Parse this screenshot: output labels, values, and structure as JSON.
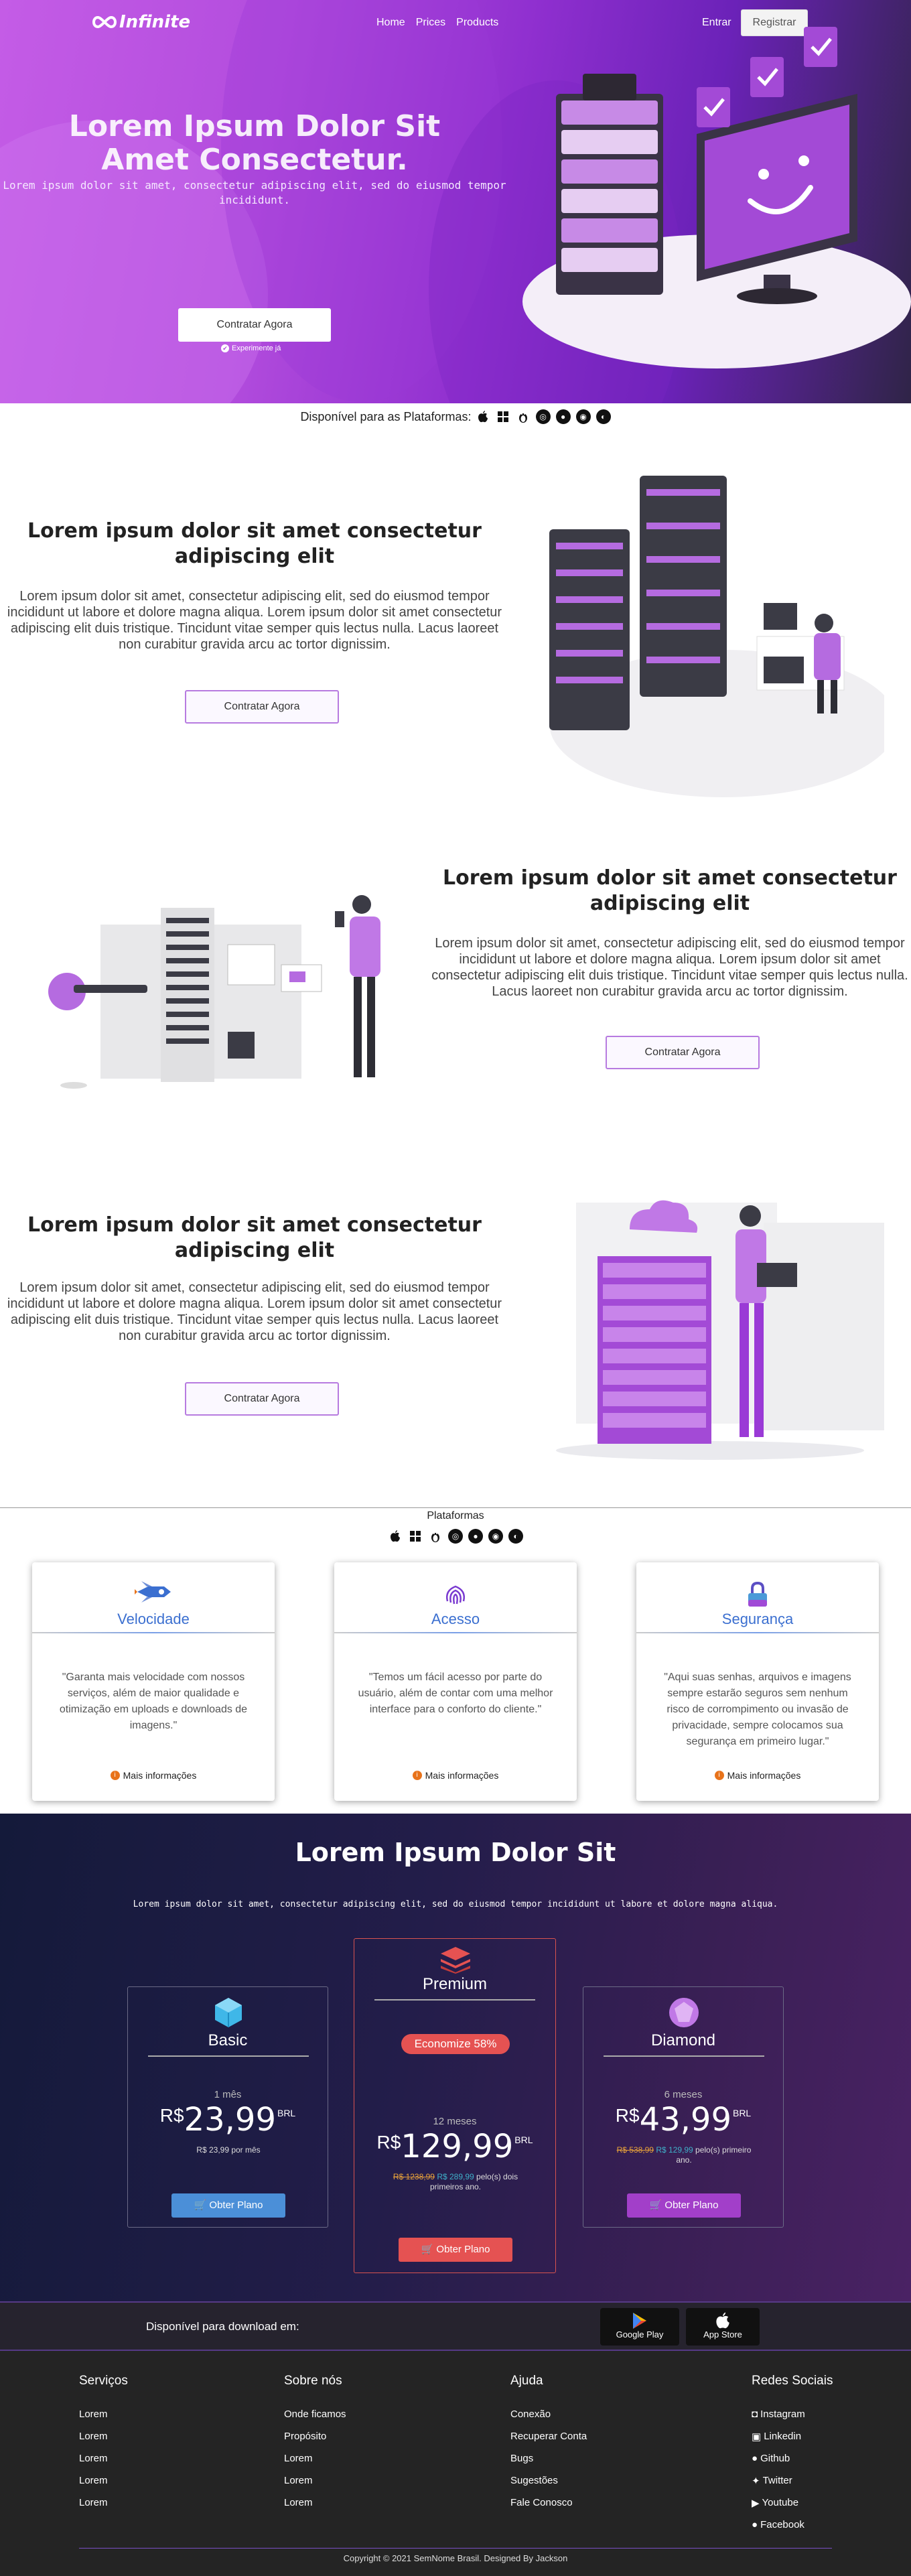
{
  "nav": {
    "logo": "Infinite",
    "links": [
      "Home",
      "Prices",
      "Products"
    ],
    "login": "Entrar",
    "register": "Registrar"
  },
  "hero": {
    "title": "Lorem Ipsum Dolor Sit Amet Consectetur.",
    "subtitle": "Lorem ipsum dolor sit amet, consectetur adipiscing elit, sed do eiusmod tempor incididunt.",
    "cta": "Contratar Agora",
    "note": "Experimente já"
  },
  "platforms_strip": {
    "label": "Disponível para as Plataformas:",
    "icons": [
      "apple-icon",
      "windows-icon",
      "linux-icon",
      "ubuntu-icon",
      "firefox-icon",
      "chrome-icon",
      "browser-icon"
    ]
  },
  "features": [
    {
      "title": "Lorem ipsum dolor sit amet consectetur adipiscing elit",
      "text": "Lorem ipsum dolor sit amet, consectetur adipiscing elit, sed do eiusmod tempor incididunt ut labore et dolore magna aliqua. Lorem ipsum dolor sit amet consectetur adipiscing elit duis tristique. Tincidunt vitae semper quis lectus nulla. Lacus laoreet non curabitur gravida arcu ac tortor dignissim.",
      "button": "Contratar Agora"
    },
    {
      "title": "Lorem ipsum dolor sit amet consectetur adipiscing elit",
      "text": "Lorem ipsum dolor sit amet, consectetur adipiscing elit, sed do eiusmod tempor incididunt ut labore et dolore magna aliqua. Lorem ipsum dolor sit amet consectetur adipiscing elit duis tristique. Tincidunt vitae semper quis lectus nulla. Lacus laoreet non curabitur gravida arcu ac tortor dignissim.",
      "button": "Contratar Agora"
    },
    {
      "title": "Lorem ipsum dolor sit amet consectetur adipiscing elit",
      "text": "Lorem ipsum dolor sit amet, consectetur adipiscing elit, sed do eiusmod tempor incididunt ut labore et dolore magna aliqua. Lorem ipsum dolor sit amet consectetur adipiscing elit duis tristique. Tincidunt vitae semper quis lectus nulla. Lacus laoreet non curabitur gravida arcu ac tortor dignissim.",
      "button": "Contratar Agora"
    }
  ],
  "platforms": {
    "label": "Plataformas",
    "cards": [
      {
        "icon": "rocket-icon",
        "title": "Velocidade",
        "quote": "\"Garanta mais velocidade com nossos serviços, além de maior qualidade e otimização em uploads e downloads de imagens.\"",
        "more": "Mais informações"
      },
      {
        "icon": "fingerprint-icon",
        "title": "Acesso",
        "quote": "\"Temos um fácil acesso por parte do usuário, além de contar com uma melhor interface para o conforto do cliente.\"",
        "more": "Mais informações"
      },
      {
        "icon": "lock-icon",
        "title": "Segurança",
        "quote": "\"Aqui suas senhas, arquivos e imagens sempre estarão seguros sem nenhum risco de corrompimento ou invasão de privacidade, sempre colocamos sua segurança em primeiro lugar.\"",
        "more": "Mais informações"
      }
    ]
  },
  "pricing": {
    "title": "Lorem Ipsum Dolor Sit",
    "subtitle": "Lorem ipsum dolor sit amet, consectetur adipiscing elit, sed do eiusmod tempor incididunt ut labore et dolore magna aliqua.",
    "plans": [
      {
        "name": "Basic",
        "period": "1 mês",
        "currency": "R$",
        "price": "23,99",
        "unit": "BRL",
        "note": "R$ 23,99 por mês",
        "button": "Obter Plano",
        "color": "#4b8fd8"
      },
      {
        "name": "Premium",
        "badge": "Economize 58%",
        "period": "12 meses",
        "currency": "R$",
        "price": "129,99",
        "unit": "BRL",
        "old_price": "R$ 1238,99",
        "new_price": "R$ 289,99",
        "note_suffix": "pelo(s) dois primeiros ano.",
        "button": "Obter Plano",
        "color": "#e55252"
      },
      {
        "name": "Diamond",
        "period": "6 meses",
        "currency": "R$",
        "price": "43,99",
        "unit": "BRL",
        "old_price": "R$ 538,99",
        "new_price": "R$ 129,99",
        "note_suffix": "pelo(s) primeiro ano.",
        "button": "Obter Plano",
        "color": "#a23fc9"
      }
    ]
  },
  "download": {
    "label": "Disponível para download em:",
    "stores": [
      "Google Play",
      "App Store"
    ]
  },
  "footer": {
    "columns": [
      {
        "title": "Serviços",
        "items": [
          "Lorem",
          "Lorem",
          "Lorem",
          "Lorem",
          "Lorem"
        ]
      },
      {
        "title": "Sobre nós",
        "items": [
          "Onde ficamos",
          "Propósito",
          "Lorem",
          "Lorem",
          "Lorem"
        ]
      },
      {
        "title": "Ajuda",
        "items": [
          "Conexão",
          "Recuperar Conta",
          "Bugs",
          "Sugestões",
          "Fale Conosco"
        ]
      },
      {
        "title": "Redes Sociais",
        "items": [
          "Instagram",
          "Linkedin",
          "Github",
          "Twitter",
          "Youtube",
          "Facebook"
        ]
      }
    ],
    "copyright": "Copyright © 2021 SemNome Brasil. Designed By Jackson"
  }
}
